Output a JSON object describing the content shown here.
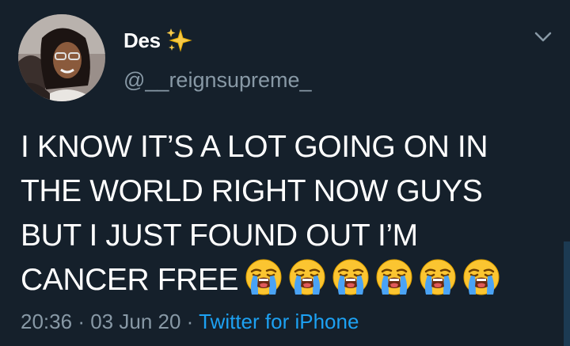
{
  "user": {
    "display_name": "Des",
    "handle": "@__reignsupreme_",
    "badge_icon": "sparkles-icon",
    "avatar_icon": "avatar-photo"
  },
  "tweet": {
    "lines": [
      "I KNOW IT’S A LOT GOING ON IN",
      "THE WORLD RIGHT NOW GUYS",
      "BUT I JUST FOUND OUT I’M",
      "CANCER FREE"
    ],
    "emoji_icon": "loudly-crying-face-icon",
    "emoji_count": 6
  },
  "meta": {
    "time": "20:36",
    "date": "03 Jun 20",
    "separator": "·",
    "source": "Twitter for iPhone"
  },
  "menu": {
    "icon": "chevron-down-icon"
  },
  "colors": {
    "background": "#15202b",
    "text": "#ffffff",
    "secondary": "#8899a6",
    "link": "#1da1f2"
  }
}
